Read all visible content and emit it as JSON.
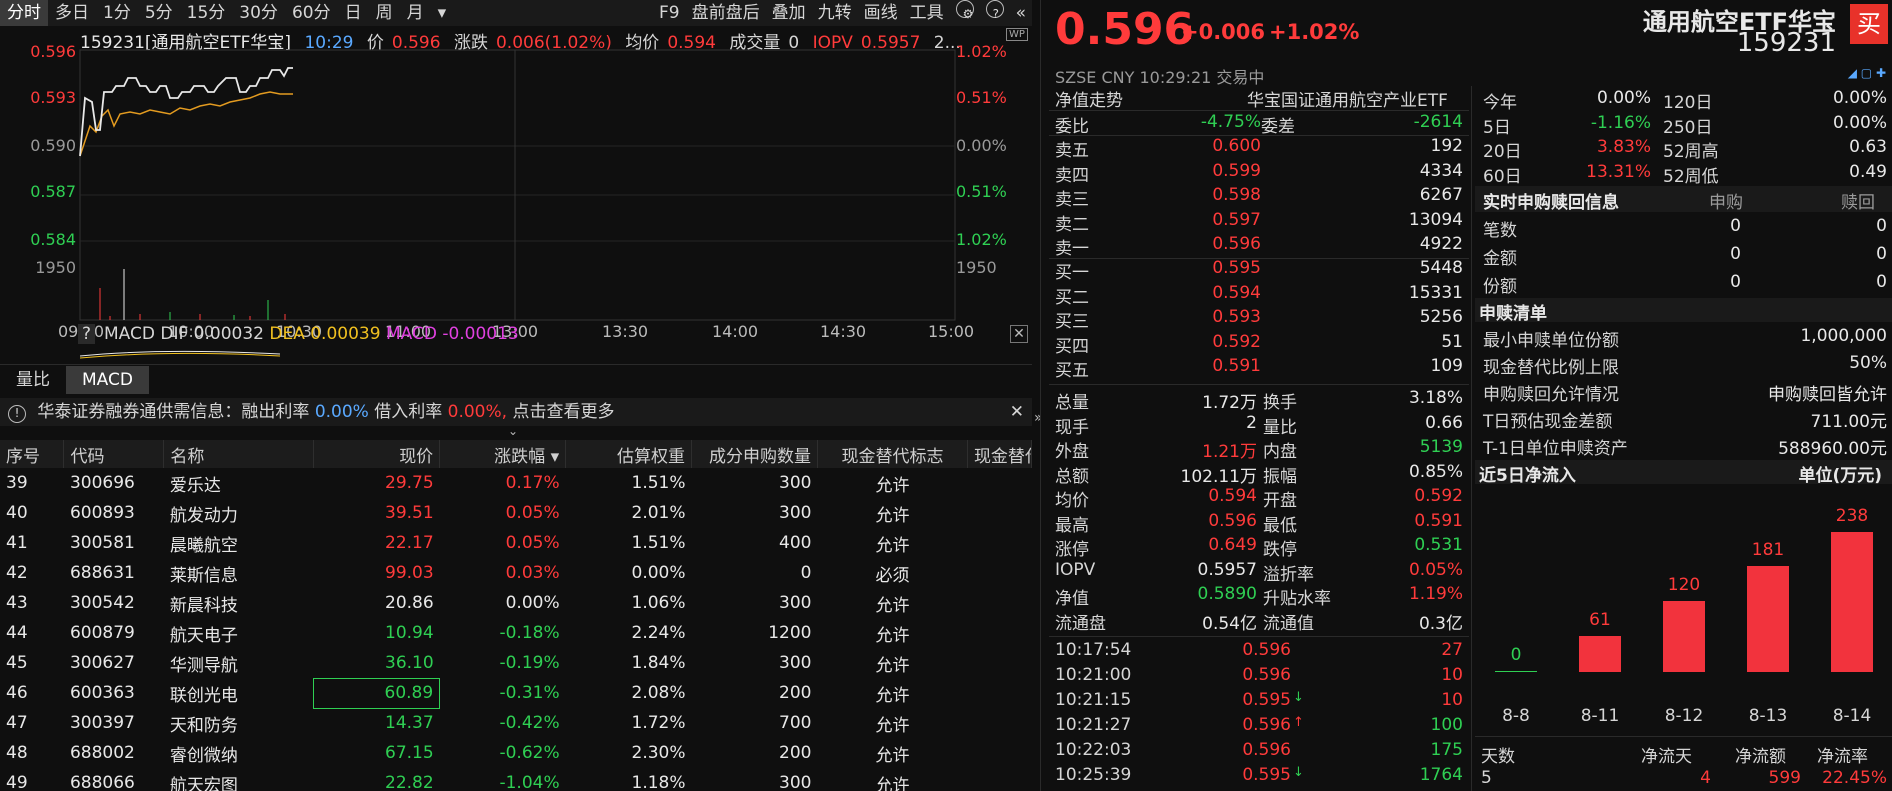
{
  "toolbar": {
    "tabs": [
      "分时",
      "多日",
      "1分",
      "5分",
      "15分",
      "30分",
      "60分",
      "日",
      "周",
      "月"
    ],
    "more": "▾",
    "right": [
      "F9",
      "盘前盘后",
      "叠加",
      "九转",
      "画线",
      "工具"
    ]
  },
  "info": {
    "code_name": "159231[通用航空ETF华宝]",
    "time": "10:29",
    "price_label": "价",
    "price": "0.596",
    "chg_label": "涨跌",
    "chg": "0.006(1.02%)",
    "avg_label": "均价",
    "avg": "0.594",
    "vol_label": "成交量",
    "vol": "0",
    "iopv_label": "IOPV",
    "iopv": "0.5957",
    "more": "2..."
  },
  "chart": {
    "y_left": [
      "0.596",
      "0.593",
      "0.590",
      "0.587",
      "0.584",
      "1950"
    ],
    "y_right": [
      "1.02%",
      "0.51%",
      "0.00%",
      "0.51%",
      "1.02%",
      "1950"
    ],
    "x": [
      "09:30",
      "10:00",
      "10:30",
      "11:00",
      "13:00",
      "13:30",
      "14:00",
      "14:30",
      "15:00"
    ]
  },
  "macd": {
    "q": "?",
    "label": "MACD",
    "dif": "DIF 0.00032",
    "dea": "DEA 0.00039",
    "macd": "MACD -0.00013"
  },
  "tabs2": [
    "量比",
    "MACD"
  ],
  "notice": {
    "text1": "华泰证券融券通供需信息：融出利率",
    "r1": "0.00%",
    "text2": "借入利率",
    "r2": "0.00%,",
    "text3": "点击查看更多"
  },
  "table": {
    "headers": [
      "序号",
      "代码",
      "名称",
      "现价",
      "涨跌幅 ▾",
      "估算权重",
      "成分申购数量",
      "现金替代标志",
      "现金替代"
    ],
    "rows": [
      [
        "39",
        "300696",
        "爱乐达",
        "29.75",
        "0.17%",
        "1.51%",
        "300",
        "允许"
      ],
      [
        "40",
        "600893",
        "航发动力",
        "39.51",
        "0.05%",
        "2.01%",
        "300",
        "允许"
      ],
      [
        "41",
        "300581",
        "晨曦航空",
        "22.17",
        "0.05%",
        "1.51%",
        "400",
        "允许"
      ],
      [
        "42",
        "688631",
        "莱斯信息",
        "99.03",
        "0.03%",
        "0.00%",
        "0",
        "必须"
      ],
      [
        "43",
        "300542",
        "新晨科技",
        "20.86",
        "0.00%",
        "1.06%",
        "300",
        "允许"
      ],
      [
        "44",
        "600879",
        "航天电子",
        "10.94",
        "-0.18%",
        "2.24%",
        "1200",
        "允许"
      ],
      [
        "45",
        "300627",
        "华测导航",
        "36.10",
        "-0.19%",
        "1.84%",
        "300",
        "允许"
      ],
      [
        "46",
        "600363",
        "联创光电",
        "60.89",
        "-0.31%",
        "2.08%",
        "200",
        "允许"
      ],
      [
        "47",
        "300397",
        "天和防务",
        "14.37",
        "-0.42%",
        "1.72%",
        "700",
        "允许"
      ],
      [
        "48",
        "688002",
        "睿创微纳",
        "67.15",
        "-0.62%",
        "2.30%",
        "200",
        "允许"
      ],
      [
        "49",
        "688066",
        "航天宏图",
        "22.82",
        "-1.04%",
        "1.18%",
        "300",
        "允许"
      ]
    ]
  },
  "quote": {
    "price": "0.596",
    "chg": "+0.006",
    "pct": "+1.02%",
    "name": "通用航空ETF华宝",
    "code": "159231",
    "buy": "买",
    "market": "SZSE CNY 10:29:21 交易中"
  },
  "nav": {
    "label": "净值走势",
    "fund": "华宝国证通用航空产业ETF"
  },
  "ratio": {
    "wb_label": "委比",
    "wb": "-4.75%",
    "wc_label": "委差",
    "wc": "-2614"
  },
  "asks": [
    [
      "卖五",
      "0.600",
      "192"
    ],
    [
      "卖四",
      "0.599",
      "4334"
    ],
    [
      "卖三",
      "0.598",
      "6267"
    ],
    [
      "卖二",
      "0.597",
      "13094"
    ],
    [
      "卖一",
      "0.596",
      "4922"
    ]
  ],
  "bids": [
    [
      "买一",
      "0.595",
      "5448"
    ],
    [
      "买二",
      "0.594",
      "15331"
    ],
    [
      "买三",
      "0.593",
      "5256"
    ],
    [
      "买四",
      "0.592",
      "51"
    ],
    [
      "买五",
      "0.591",
      "109"
    ]
  ],
  "stats": [
    [
      "总量",
      "1.72万",
      "换手",
      "3.18%"
    ],
    [
      "现手",
      "2",
      "量比",
      "0.66"
    ],
    [
      "外盘",
      "1.21万",
      "内盘",
      "5139"
    ],
    [
      "总额",
      "102.11万",
      "振幅",
      "0.85%"
    ],
    [
      "均价",
      "0.594",
      "开盘",
      "0.592"
    ],
    [
      "最高",
      "0.596",
      "最低",
      "0.591"
    ],
    [
      "涨停",
      "0.649",
      "跌停",
      "0.531"
    ],
    [
      "IOPV",
      "0.5957",
      "溢折率",
      "0.05%"
    ],
    [
      "净值",
      "0.5890",
      "升贴水率",
      "1.19%"
    ],
    [
      "流通盘",
      "0.54亿",
      "流通值",
      "0.3亿"
    ]
  ],
  "ticks": [
    [
      "10:17:54",
      "0.596",
      "",
      "27"
    ],
    [
      "10:21:00",
      "0.596",
      "",
      "10"
    ],
    [
      "10:21:15",
      "0.595",
      "↓",
      "10"
    ],
    [
      "10:21:27",
      "0.596",
      "↑",
      "100"
    ],
    [
      "10:22:03",
      "0.596",
      "",
      "175"
    ],
    [
      "10:25:39",
      "0.595",
      "↓",
      "1764"
    ]
  ],
  "perf": [
    [
      "今年",
      "0.00%",
      "120日",
      "0.00%"
    ],
    [
      "5日",
      "-1.16%",
      "250日",
      "0.00%"
    ],
    [
      "20日",
      "3.83%",
      "52周高",
      "0.63"
    ],
    [
      "60日",
      "13.31%",
      "52周低",
      "0.49"
    ]
  ],
  "sg": {
    "title": "实时申购赎回信息",
    "c1": "申购",
    "c2": "赎回",
    "rows": [
      [
        "笔数",
        "0",
        "0"
      ],
      [
        "金额",
        "0",
        "0"
      ],
      [
        "份额",
        "0",
        "0"
      ]
    ]
  },
  "list": {
    "title": "申赎清单",
    "rows": [
      [
        "最小申赎单位份额",
        "1,000,000"
      ],
      [
        "现金替代比例上限",
        "50%"
      ],
      [
        "申购赎回允许情况",
        "申购赎回皆允许"
      ],
      [
        "T日预估现金差额",
        "711.00元"
      ],
      [
        "T-1日单位申赎资产",
        "588960.00元"
      ]
    ]
  },
  "flow": {
    "title": "近5日净流入",
    "unit": "单位(万元)",
    "dates": [
      "8-8",
      "8-11",
      "8-12",
      "8-13",
      "8-14"
    ],
    "values": [
      0,
      61,
      120,
      181,
      238
    ]
  },
  "summary": {
    "h1": "天数",
    "h2": "净流天",
    "h3": "净流额",
    "h4": "净流率",
    "v1": "5",
    "v2": "4",
    "v3": "599",
    "v4": "22.45%"
  }
}
